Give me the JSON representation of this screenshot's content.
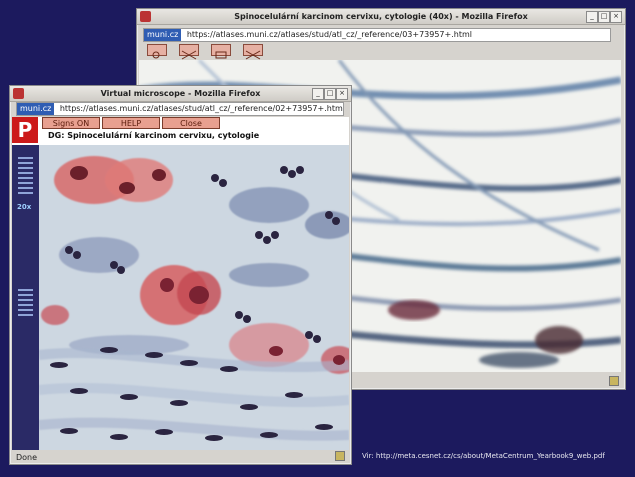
{
  "window_back": {
    "title": "Spinocelulární karcinom cervixu, cytologie (40x) - Mozilla Firefox",
    "address_site": "muni.cz",
    "address_url": "https://atlases.muni.cz/atlases/stud/atl_cz/_reference/03+73957+.html",
    "tools": [
      "zoom-in-icon",
      "zoom-out-crossed-icon",
      "screen-icon",
      "close-crossed-icon"
    ]
  },
  "window_front": {
    "title": "Virtual microscope - Mozilla Firefox",
    "address_site": "muni.cz",
    "address_url": "https://atlases.muni.cz/atlases/stud/atl_cz/_reference/02+73957+.htm",
    "buttons": {
      "signs": "Signs ON",
      "help": "HELP",
      "close": "Close"
    },
    "diagnosis": "DG: Spinocelulární karcinom cervixu, cytologie",
    "zoom_label": "20x",
    "status": "Done"
  },
  "caption": "Vir: http://meta.cesnet.cz/cs/about/MetaCentrum_Yearbook9_web.pdf",
  "colors": {
    "background": "#1c1a5e",
    "nav_panel": "#2a2a66",
    "button_red": "#e8a090",
    "logo_red": "#cc1a1a"
  }
}
